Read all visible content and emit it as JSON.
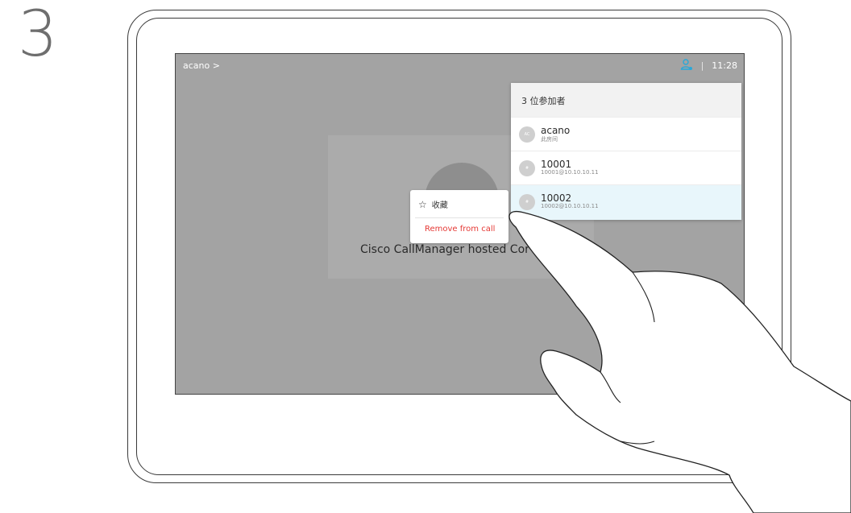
{
  "step_number": "3",
  "topbar": {
    "room": "acano >",
    "time": "11:28"
  },
  "call": {
    "title": "Cisco CallManager hosted Cor"
  },
  "menu": {
    "favorite": "收藏",
    "remove": "Remove from call"
  },
  "participants": {
    "title": "3 位参加者",
    "items": [
      {
        "initials": "AC",
        "name": "acano",
        "sub": "此房间"
      },
      {
        "initials": "#",
        "name": "10001",
        "sub": "10001@10.10.10.11"
      },
      {
        "initials": "#",
        "name": "10002",
        "sub": "10002@10.10.10.11"
      }
    ]
  },
  "colors": {
    "accent": "#29a8d9",
    "remove": "#e53935",
    "screen": "#a3a3a3"
  }
}
